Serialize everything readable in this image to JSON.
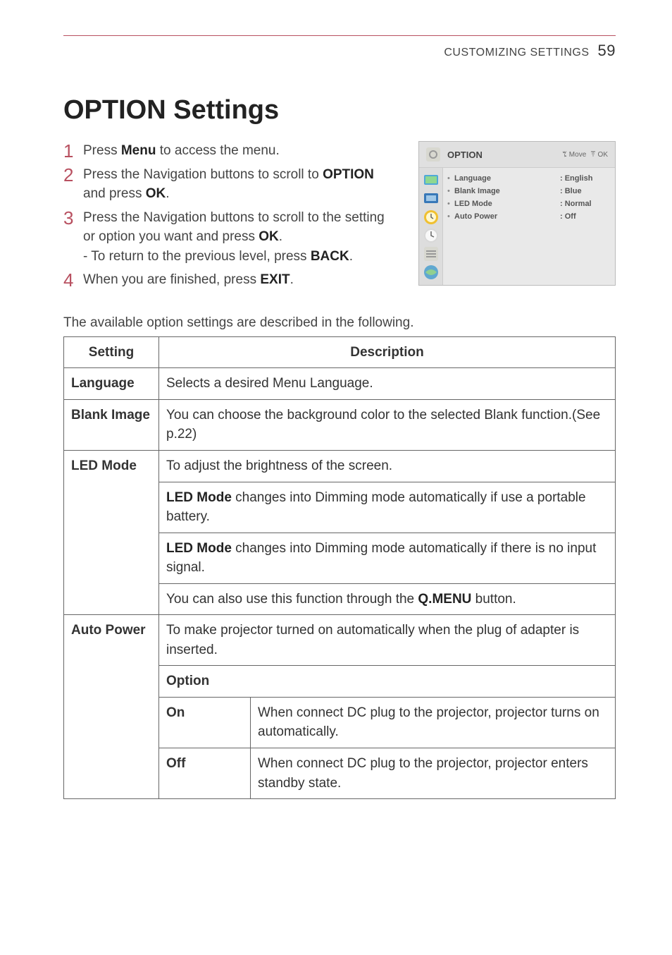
{
  "header": {
    "section": "CUSTOMIZING SETTINGS",
    "page": "59"
  },
  "title": "OPTION Settings",
  "steps": {
    "s1_a": "Press ",
    "s1_b": "Menu",
    "s1_c": " to access the menu.",
    "s2_a": "Press the Navigation buttons to scroll to ",
    "s2_b": "OPTION",
    "s2_c": " and press ",
    "s2_d": "OK",
    "s2_e": ".",
    "s3_a": "Press the Navigation buttons to scroll to the setting or option you want and press ",
    "s3_b": "OK",
    "s3_c": ".",
    "s3_sub_a": "- To return to the previous level, press ",
    "s3_sub_b": "BACK",
    "s3_sub_c": ".",
    "s4_a": "When you are finished, press ",
    "s4_b": "EXIT",
    "s4_c": "."
  },
  "osd": {
    "title": "OPTION",
    "hint_move": "ꔂ Move",
    "hint_ok": "ꔉ OK",
    "rows": [
      {
        "label": "Language",
        "value": ": English"
      },
      {
        "label": "Blank Image",
        "value": ": Blue"
      },
      {
        "label": "LED Mode",
        "value": ": Normal"
      },
      {
        "label": "Auto Power",
        "value": ": Off"
      }
    ]
  },
  "intro": "The available option settings are described in the following.",
  "table": {
    "head_setting": "Setting",
    "head_desc": "Description",
    "language": {
      "label": "Language",
      "desc": "Selects a desired Menu Language."
    },
    "blank": {
      "label": "Blank Image",
      "desc": "You can choose the background color to the selected Blank function.(See p.22)"
    },
    "led": {
      "label": "LED Mode",
      "d1": "To adjust the brightness of the screen.",
      "d2a": "LED Mode",
      "d2b": " changes into Dimming mode automatically if use a portable battery.",
      "d3a": "LED Mode",
      "d3b": " changes into Dimming mode automatically if there is no input signal.",
      "d4a": "You can also use this function through the ",
      "d4b": "Q.MENU",
      "d4c": " button."
    },
    "auto": {
      "label": "Auto Power",
      "desc": "To make projector turned on automatically when the plug of adapter is inserted.",
      "option_head": "Option",
      "on_label": "On",
      "on_desc": "When connect DC plug to the projector, projector turns on automatically.",
      "off_label": "Off",
      "off_desc": "When connect DC plug to the projector, projector enters standby state."
    }
  }
}
